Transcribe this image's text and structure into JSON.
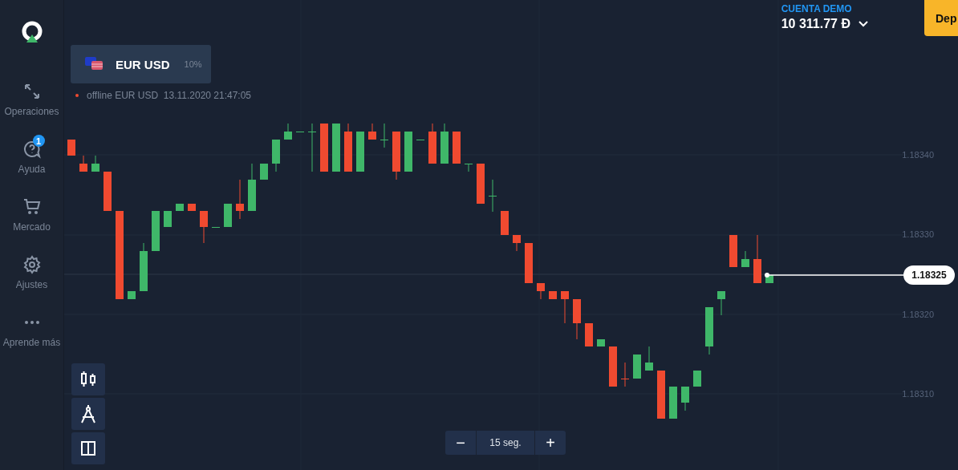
{
  "sidebar": {
    "items": [
      {
        "label": "Operaciones"
      },
      {
        "label": "Ayuda",
        "badge": "1"
      },
      {
        "label": "Mercado"
      },
      {
        "label": "Ajustes"
      },
      {
        "label": "Aprende más"
      }
    ]
  },
  "account": {
    "label": "CUENTA DEMO",
    "balance": "10 311.77 Đ"
  },
  "deposit_button": "Dep",
  "asset": {
    "name": "EUR USD",
    "payout": "10%"
  },
  "status": {
    "online": false,
    "text": "offline EUR USD  13.11.2020 21:47:05"
  },
  "price_axis": [
    "1.18340",
    "1.18330",
    "1.18320",
    "1.18310"
  ],
  "current_price": "1.18325",
  "timeframe": {
    "decrease": "−",
    "value": "15 seg.",
    "increase": "+"
  }
}
